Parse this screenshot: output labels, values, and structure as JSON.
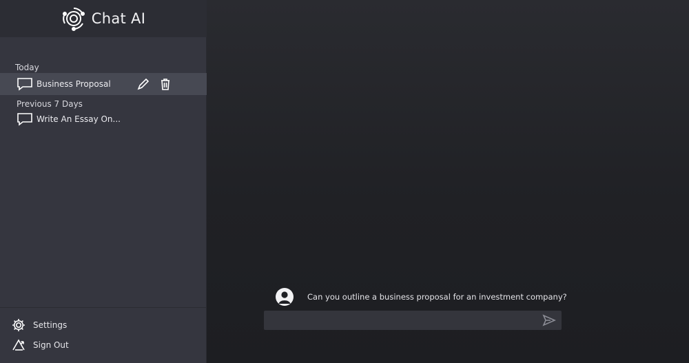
{
  "app": {
    "title": "Chat AI"
  },
  "sidebar": {
    "sections": [
      {
        "label": "Today",
        "items": [
          {
            "label": "Business Proposal",
            "active": true
          }
        ]
      },
      {
        "label": "Previous 7 Days",
        "items": [
          {
            "label": "Write An Essay On..."
          }
        ]
      }
    ],
    "footer": {
      "settings_label": "Settings",
      "signout_label": "Sign Out"
    }
  },
  "chat": {
    "messages": [
      {
        "role": "user",
        "text": "Can you outline a business proposal for an investment company?"
      }
    ],
    "input": {
      "value": "",
      "placeholder": ""
    }
  },
  "icons": {
    "brand": "brand-logo-icon",
    "chat": "chat-bubble-icon",
    "edit": "pencil-icon",
    "delete": "trash-icon",
    "settings": "gear-icon",
    "signout": "sign-out-icon",
    "user": "user-avatar-icon",
    "send": "send-icon"
  },
  "colors": {
    "sidebar": "#35363f",
    "active_item": "#474953",
    "main_bg": "#202125",
    "input_bg": "#34353c"
  }
}
